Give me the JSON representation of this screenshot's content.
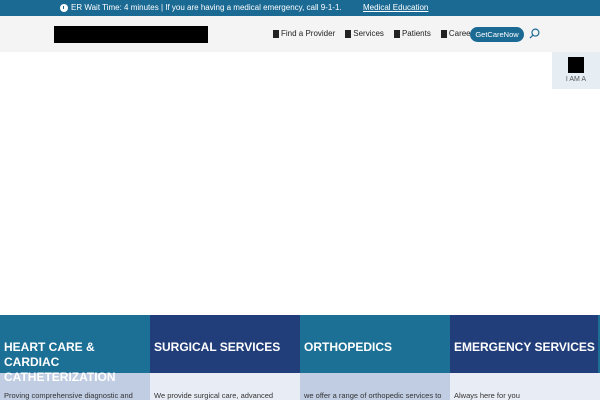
{
  "topbar": {
    "clock_icon": "clock-icon",
    "alert_text": "ER Wait Time: 4 minutes | If you are having a medical emergency, call 9-1-1.",
    "link_text": "Medical Education"
  },
  "header": {
    "nav": [
      {
        "label": "Find a Provider",
        "icon": "provider-icon"
      },
      {
        "label": "Services",
        "icon": "services-icon"
      },
      {
        "label": "Patients",
        "icon": "patients-icon"
      },
      {
        "label": "Careers",
        "icon": "careers-icon"
      }
    ],
    "cta_label": "GetCareNow",
    "search_icon": "search-icon"
  },
  "side_widget": {
    "label": "I AM A"
  },
  "tiles": [
    {
      "title": "HEART CARE & CARDIAC CATHETERIZATION",
      "text": "Proving comprehensive diagnostic and"
    },
    {
      "title": "SURGICAL SERVICES",
      "text": "We provide surgical care, advanced"
    },
    {
      "title": "ORTHOPEDICS",
      "text": "we offer a range of orthopedic services to"
    },
    {
      "title": "EMERGENCY SERVICES",
      "text": "Always here for you"
    }
  ],
  "colors": {
    "brand_blue": "#1b6a94",
    "navy": "#213e7a",
    "header_bg": "#f4f4f4"
  }
}
